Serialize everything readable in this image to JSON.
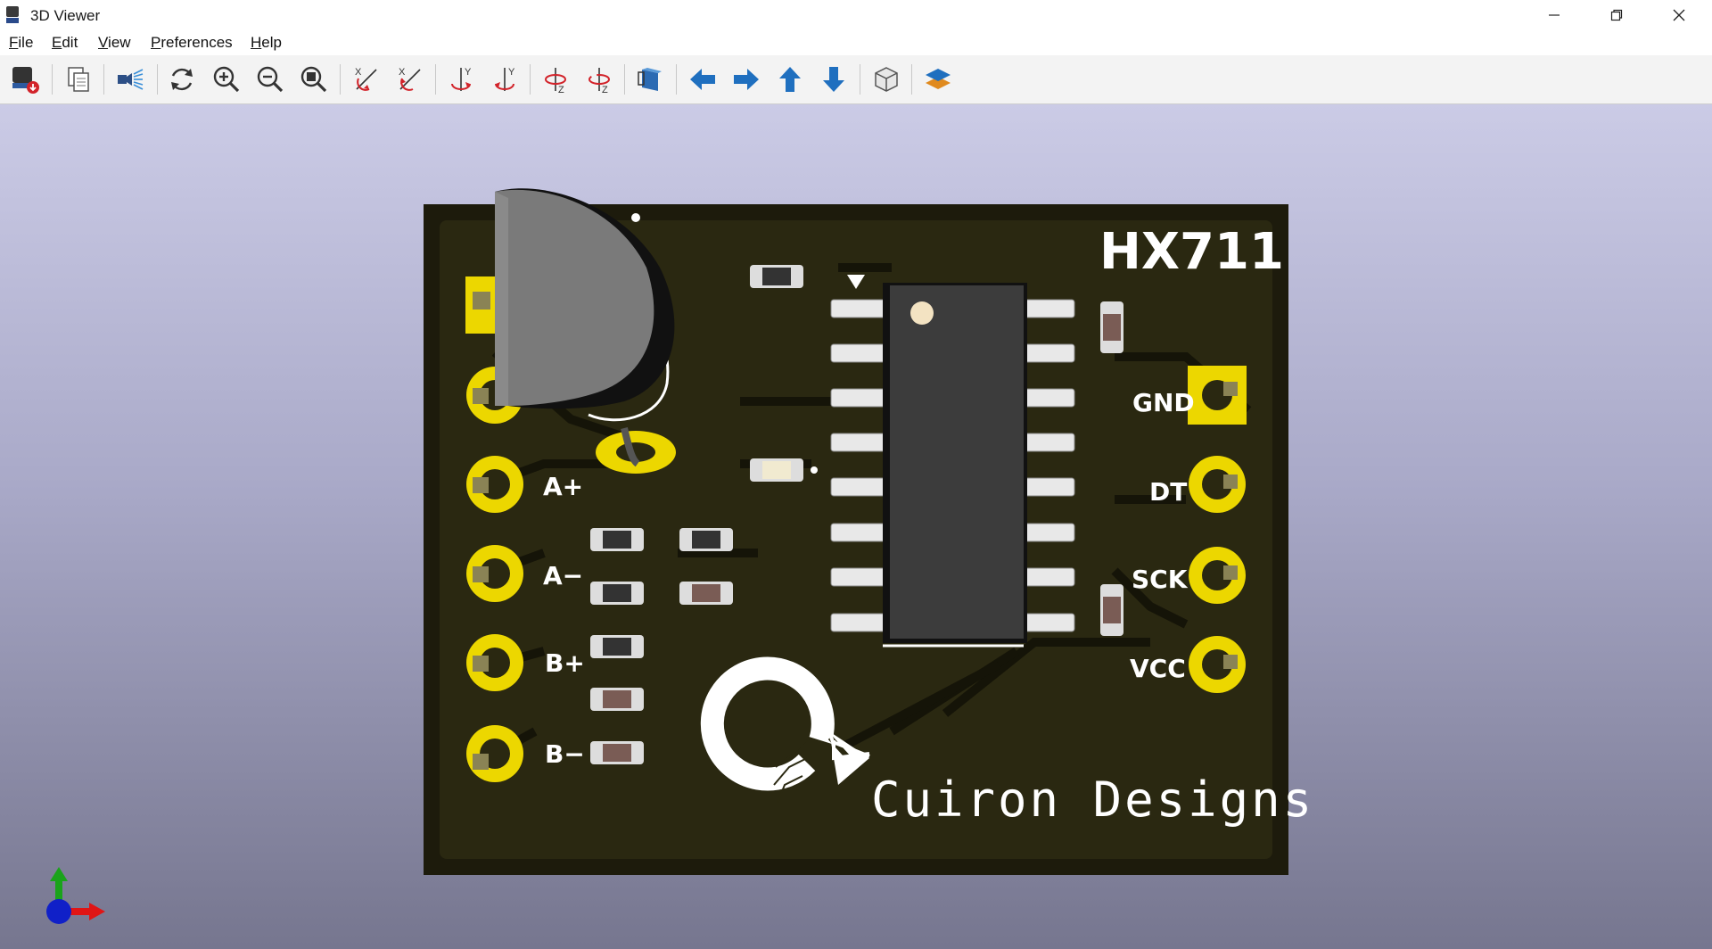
{
  "window": {
    "title": "3D Viewer"
  },
  "menu": {
    "file": "File",
    "edit": "Edit",
    "view": "View",
    "preferences": "Preferences",
    "help": "Help"
  },
  "toolbar": {
    "icons": [
      "render-icon",
      "copy-icon",
      "raytrace-icon",
      "reload-icon",
      "zoom-in-icon",
      "zoom-out-icon",
      "zoom-fit-icon",
      "rotate-x-cw-icon",
      "rotate-x-ccw-icon",
      "rotate-y-cw-icon",
      "rotate-y-ccw-icon",
      "rotate-z-cw-icon",
      "rotate-z-ccw-icon",
      "flip-board-icon",
      "pan-left-icon",
      "pan-right-icon",
      "pan-up-icon",
      "pan-down-icon",
      "ortho-icon",
      "layers-icon"
    ]
  },
  "board": {
    "title": "HX711",
    "brand": "Cuiron Designs",
    "left_pads": [
      "A+",
      "A−",
      "B+",
      "B−"
    ],
    "right_pads": [
      "GND",
      "DT",
      "SCK",
      "VCC"
    ],
    "colors": {
      "soldermask": "#1d1b0c",
      "copper": "#ecd700",
      "silkscreen": "#ffffff",
      "chip": "#3c3c3c"
    }
  }
}
